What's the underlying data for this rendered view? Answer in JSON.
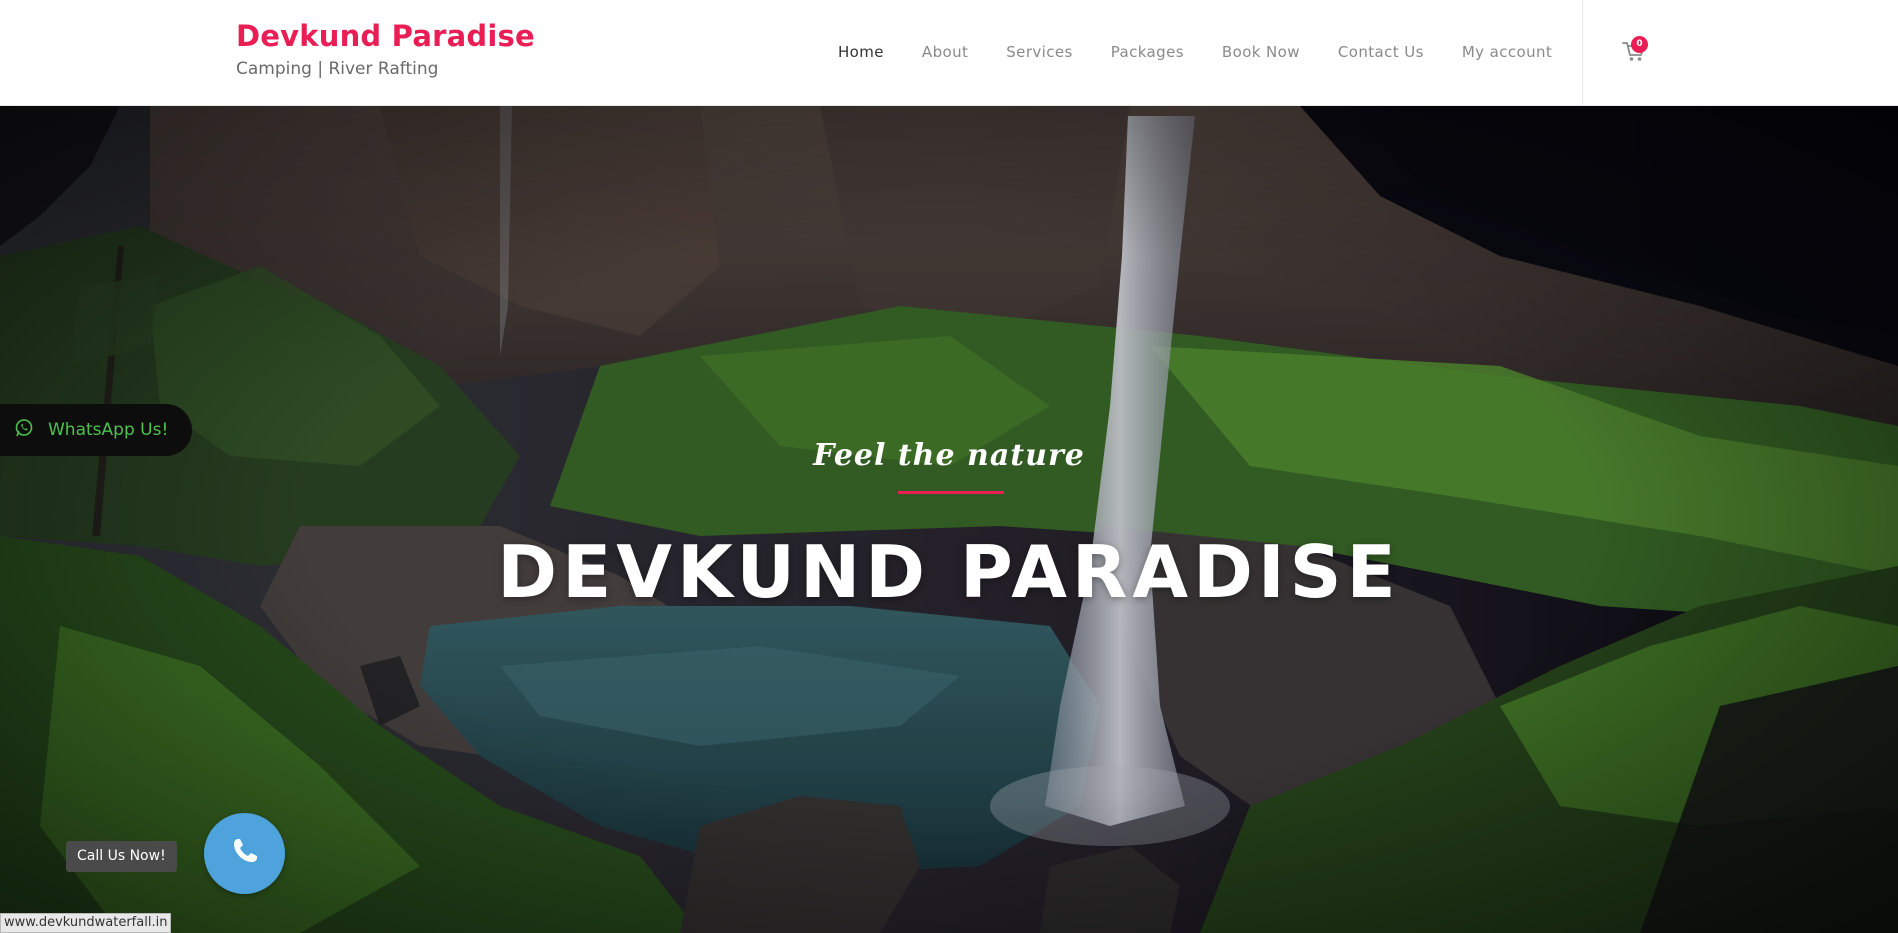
{
  "brand": {
    "title": "Devkund Paradise",
    "tagline": "Camping | River Rafting"
  },
  "nav": {
    "items": [
      {
        "label": "Home",
        "active": true
      },
      {
        "label": "About",
        "active": false
      },
      {
        "label": "Services",
        "active": false
      },
      {
        "label": "Packages",
        "active": false
      },
      {
        "label": "Book Now",
        "active": false
      },
      {
        "label": "Contact Us",
        "active": false
      },
      {
        "label": "My account",
        "active": false
      }
    ]
  },
  "cart": {
    "icon": "cart-icon",
    "count": "0"
  },
  "hero": {
    "subtitle": "Feel the nature",
    "title": "DEVKUND PARADISE"
  },
  "whatsapp": {
    "icon": "whatsapp-icon",
    "label": "WhatsApp Us!"
  },
  "call": {
    "icon": "phone-icon",
    "label": "Call Us Now!"
  },
  "status_bar": {
    "url": "www.devkundwaterfall.in"
  },
  "colors": {
    "accent": "#e91e55",
    "whatsapp_green": "#4cc44c",
    "call_blue": "#4ea3dc",
    "nav_text": "#8a8a8a",
    "nav_active": "#333333"
  }
}
